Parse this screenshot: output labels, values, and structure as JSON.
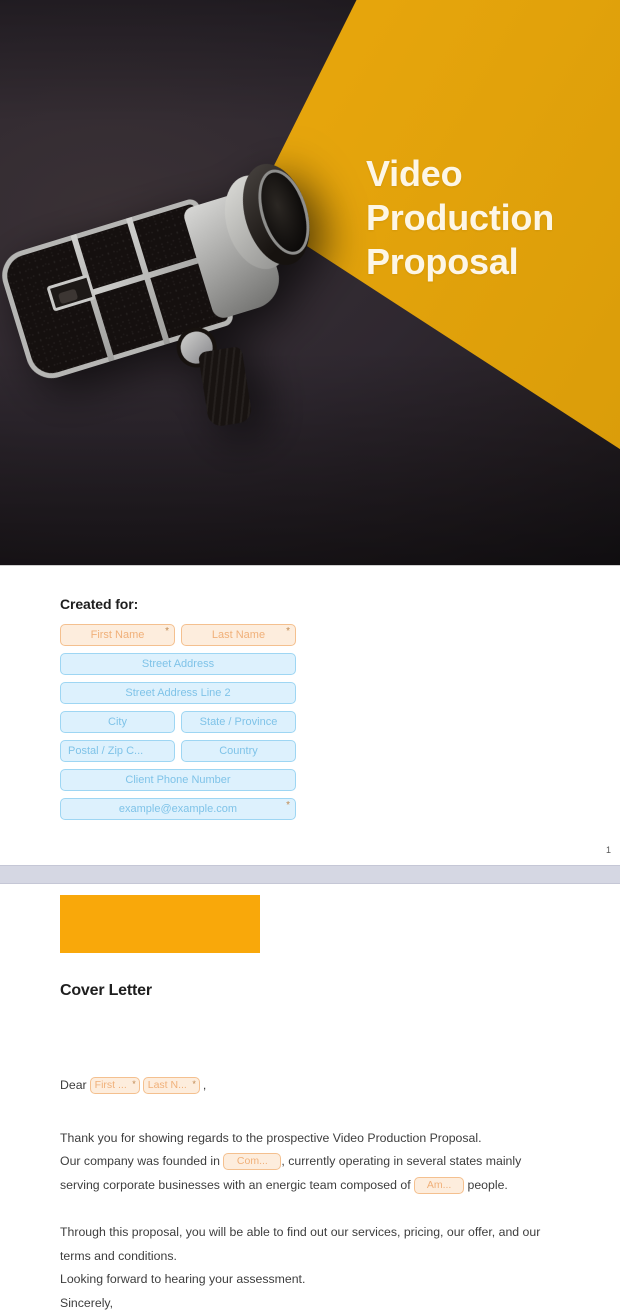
{
  "document": {
    "colors": {
      "accent_yellow": "#edaa10",
      "block_orange": "#f9a80a",
      "hero_dark": "#2e272b",
      "field_blue_bg": "#ddf1fd",
      "field_blue_border": "#9ed6f3",
      "field_blue_text": "#7fc3e8",
      "field_orange_bg": "#fdeddd",
      "field_orange_border": "#f4c08f",
      "field_orange_text": "#f0b079",
      "page_break_band": "#d5d7e3",
      "body_text": "#3d3d3d"
    }
  },
  "hero": {
    "title_line1": "Video",
    "title_line2": "Production",
    "title_line3": "Proposal",
    "image_alt": "vintage-super-8-film-camera-on-dark-background"
  },
  "page1": {
    "created_for_label": "Created for:",
    "page_number": "1",
    "fields": [
      {
        "placeholder": "First Name",
        "style": "orange",
        "width": "half",
        "required": true,
        "align": "center"
      },
      {
        "placeholder": "Last Name",
        "style": "orange",
        "width": "half",
        "required": true,
        "align": "center"
      },
      {
        "placeholder": "Street Address",
        "style": "blue",
        "width": "full",
        "required": false,
        "align": "center"
      },
      {
        "placeholder": "Street Address Line 2",
        "style": "blue",
        "width": "full",
        "required": false,
        "align": "center"
      },
      {
        "placeholder": "City",
        "style": "blue",
        "width": "half",
        "required": false,
        "align": "center"
      },
      {
        "placeholder": "State / Province",
        "style": "blue",
        "width": "half",
        "required": false,
        "align": "center"
      },
      {
        "placeholder": "Postal / Zip C...",
        "style": "blue",
        "width": "half",
        "required": false,
        "align": "left"
      },
      {
        "placeholder": "Country",
        "style": "blue",
        "width": "half",
        "required": false,
        "align": "center"
      },
      {
        "placeholder": "Client Phone Number",
        "style": "blue",
        "width": "full",
        "required": false,
        "align": "center"
      },
      {
        "placeholder": "example@example.com",
        "style": "blue",
        "width": "full",
        "required": true,
        "align": "center"
      }
    ]
  },
  "page2": {
    "section_title": "Cover Letter",
    "salutation_word": "Dear",
    "salutation_first": "First ...",
    "salutation_last": "Last N...",
    "salutation_comma": ",",
    "para1": "Thank you for showing regards to the prospective Video Production Proposal.",
    "para2_a": "Our company was founded in",
    "para2_field": "Com...",
    "para2_b": ", currently operating in several states mainly",
    "para3_a": "serving corporate businesses with an energic team composed of",
    "para3_field": "Am...",
    "para3_b": "people.",
    "para4": "Through this proposal, you will be able to find out our services, pricing, our offer, and our",
    "para5": "terms and conditions.",
    "para6": "Looking forward to hearing your assessment.",
    "para7": "Sincerely,"
  }
}
